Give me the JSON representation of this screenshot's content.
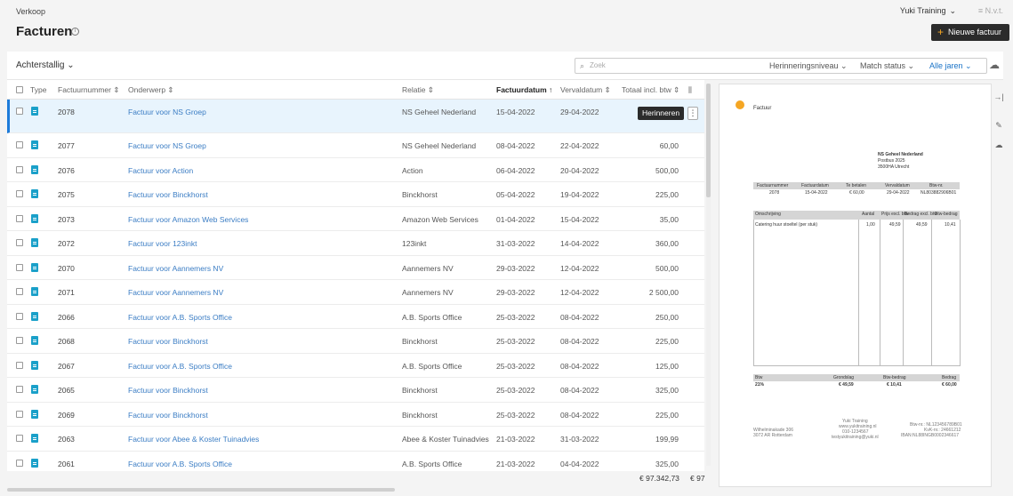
{
  "breadcrumb": "Verkoop",
  "page_title": "Facturen",
  "admin_name": "Yuki Training",
  "admin_extra": "N.v.t.",
  "new_invoice_label": "Nieuwe factuur",
  "filter": {
    "view": "Achterstallig",
    "search_placeholder": "Zoek",
    "reminder_level": "Herinneringsniveau",
    "match_status": "Match status",
    "years": "Alle jaren"
  },
  "columns": {
    "type": "Type",
    "number": "Factuurnummer",
    "subject": "Onderwerp",
    "relation": "Relatie",
    "invoice_date": "Factuurdatum",
    "due_date": "Vervaldatum",
    "total": "Totaal incl. btw"
  },
  "rows": [
    {
      "number": "2078",
      "subject": "Factuur voor NS Groep",
      "relation": "NS Geheel Nederland",
      "invoice_date": "15-04-2022",
      "due_date": "29-04-2022",
      "total": ""
    },
    {
      "number": "2077",
      "subject": "Factuur voor NS Groep",
      "relation": "NS Geheel Nederland",
      "invoice_date": "08-04-2022",
      "due_date": "22-04-2022",
      "total": "60,00"
    },
    {
      "number": "2076",
      "subject": "Factuur voor Action",
      "relation": "Action",
      "invoice_date": "06-04-2022",
      "due_date": "20-04-2022",
      "total": "500,00"
    },
    {
      "number": "2075",
      "subject": "Factuur voor Binckhorst",
      "relation": "Binckhorst",
      "invoice_date": "05-04-2022",
      "due_date": "19-04-2022",
      "total": "225,00"
    },
    {
      "number": "2073",
      "subject": "Factuur voor Amazon Web Services",
      "relation": "Amazon Web Services",
      "invoice_date": "01-04-2022",
      "due_date": "15-04-2022",
      "total": "35,00"
    },
    {
      "number": "2072",
      "subject": "Factuur voor 123inkt",
      "relation": "123inkt",
      "invoice_date": "31-03-2022",
      "due_date": "14-04-2022",
      "total": "360,00"
    },
    {
      "number": "2070",
      "subject": "Factuur voor Aannemers NV",
      "relation": "Aannemers NV",
      "invoice_date": "29-03-2022",
      "due_date": "12-04-2022",
      "total": "500,00"
    },
    {
      "number": "2071",
      "subject": "Factuur voor Aannemers NV",
      "relation": "Aannemers NV",
      "invoice_date": "29-03-2022",
      "due_date": "12-04-2022",
      "total": "2 500,00"
    },
    {
      "number": "2066",
      "subject": "Factuur voor A.B. Sports Office",
      "relation": "A.B. Sports Office",
      "invoice_date": "25-03-2022",
      "due_date": "08-04-2022",
      "total": "250,00"
    },
    {
      "number": "2068",
      "subject": "Factuur voor Binckhorst",
      "relation": "Binckhorst",
      "invoice_date": "25-03-2022",
      "due_date": "08-04-2022",
      "total": "225,00"
    },
    {
      "number": "2067",
      "subject": "Factuur voor A.B. Sports Office",
      "relation": "A.B. Sports Office",
      "invoice_date": "25-03-2022",
      "due_date": "08-04-2022",
      "total": "125,00"
    },
    {
      "number": "2065",
      "subject": "Factuur voor Binckhorst",
      "relation": "Binckhorst",
      "invoice_date": "25-03-2022",
      "due_date": "08-04-2022",
      "total": "325,00"
    },
    {
      "number": "2069",
      "subject": "Factuur voor Binckhorst",
      "relation": "Binckhorst",
      "invoice_date": "25-03-2022",
      "due_date": "08-04-2022",
      "total": "225,00"
    },
    {
      "number": "2063",
      "subject": "Factuur voor Abee & Koster Tuinadvies",
      "relation": "Abee & Koster Tuinadvies",
      "invoice_date": "21-03-2022",
      "due_date": "31-03-2022",
      "total": "199,99"
    },
    {
      "number": "2061",
      "subject": "Factuur voor A.B. Sports Office",
      "relation": "A.B. Sports Office",
      "invoice_date": "21-03-2022",
      "due_date": "04-04-2022",
      "total": "325,00"
    }
  ],
  "selected_row_action": "Herinneren",
  "grand_total": "€ 97.342,73",
  "grand_total_cut": "€ 97",
  "preview": {
    "title": "Factuur",
    "address": [
      "NS Geheel Nederland",
      "Postbus 2025",
      "3500HA  Utrecht"
    ],
    "meta_headers": [
      "Factuurnummer",
      "Factuurdatum",
      "Te betalen",
      "Vervaldatum",
      "Btw-nr."
    ],
    "meta_values": [
      "2078",
      "15-04-2022",
      "€ 60,00",
      "29-04-2022",
      "NL803882906B01"
    ],
    "line_headers": [
      "Omschrijving",
      "Aantal",
      "Prijs excl. btw",
      "Bedrag excl. btw",
      "Btw-bedrag"
    ],
    "line_values": [
      "Catering huur stoeltel (per stuk)",
      "1,00",
      "49,59",
      "49,59",
      "10,41"
    ],
    "vat_headers": [
      "Btw",
      "Grondslag",
      "Btw-bedrag",
      "Bedrag"
    ],
    "vat_values": [
      "21%",
      "€ 49,59",
      "€ 10,41",
      "€ 60,00"
    ],
    "footer_left": [
      "Wilhelminakade 306",
      "3072 AR Rotterdam"
    ],
    "footer_mid": [
      "Yuki Training",
      "www.yukitraining.nl",
      "010-1234567",
      "testyukitraining@yuki.nl"
    ],
    "footer_right": [
      "Btw-nr.: NL123456789B01",
      "KvK-nr.: 24661212",
      "IBAN:NL88INGB0002346617"
    ]
  }
}
